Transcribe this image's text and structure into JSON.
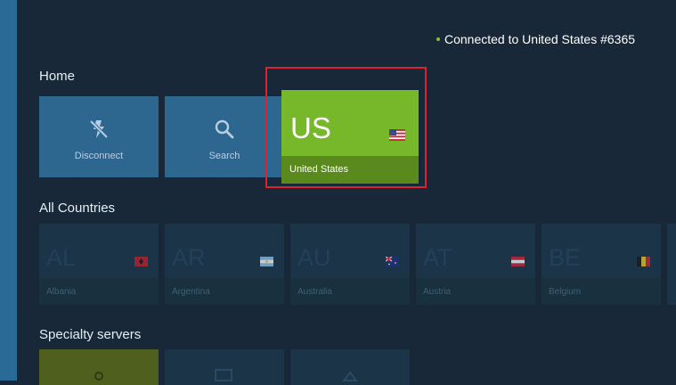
{
  "status": {
    "text": "Connected to United States #6365",
    "dot_color": "#7cc142"
  },
  "home": {
    "title": "Home",
    "disconnect_label": "Disconnect",
    "search_label": "Search",
    "current_country": {
      "code": "US",
      "name": "United States"
    }
  },
  "all_countries": {
    "title": "All Countries",
    "items": [
      {
        "code": "AL",
        "name": "Albania",
        "flag_icon": "albania-flag-icon"
      },
      {
        "code": "AR",
        "name": "Argentina",
        "flag_icon": "argentina-flag-icon"
      },
      {
        "code": "AU",
        "name": "Australia",
        "flag_icon": "australia-flag-icon"
      },
      {
        "code": "AT",
        "name": "Austria",
        "flag_icon": "austria-flag-icon"
      },
      {
        "code": "BE",
        "name": "Belgium",
        "flag_icon": "belgium-flag-icon"
      }
    ]
  },
  "specialty": {
    "title": "Specialty servers"
  },
  "colors": {
    "background": "#182838",
    "accent_green": "#76b82a",
    "tile_blue": "#2d6790",
    "highlight_red": "#d9232e"
  }
}
